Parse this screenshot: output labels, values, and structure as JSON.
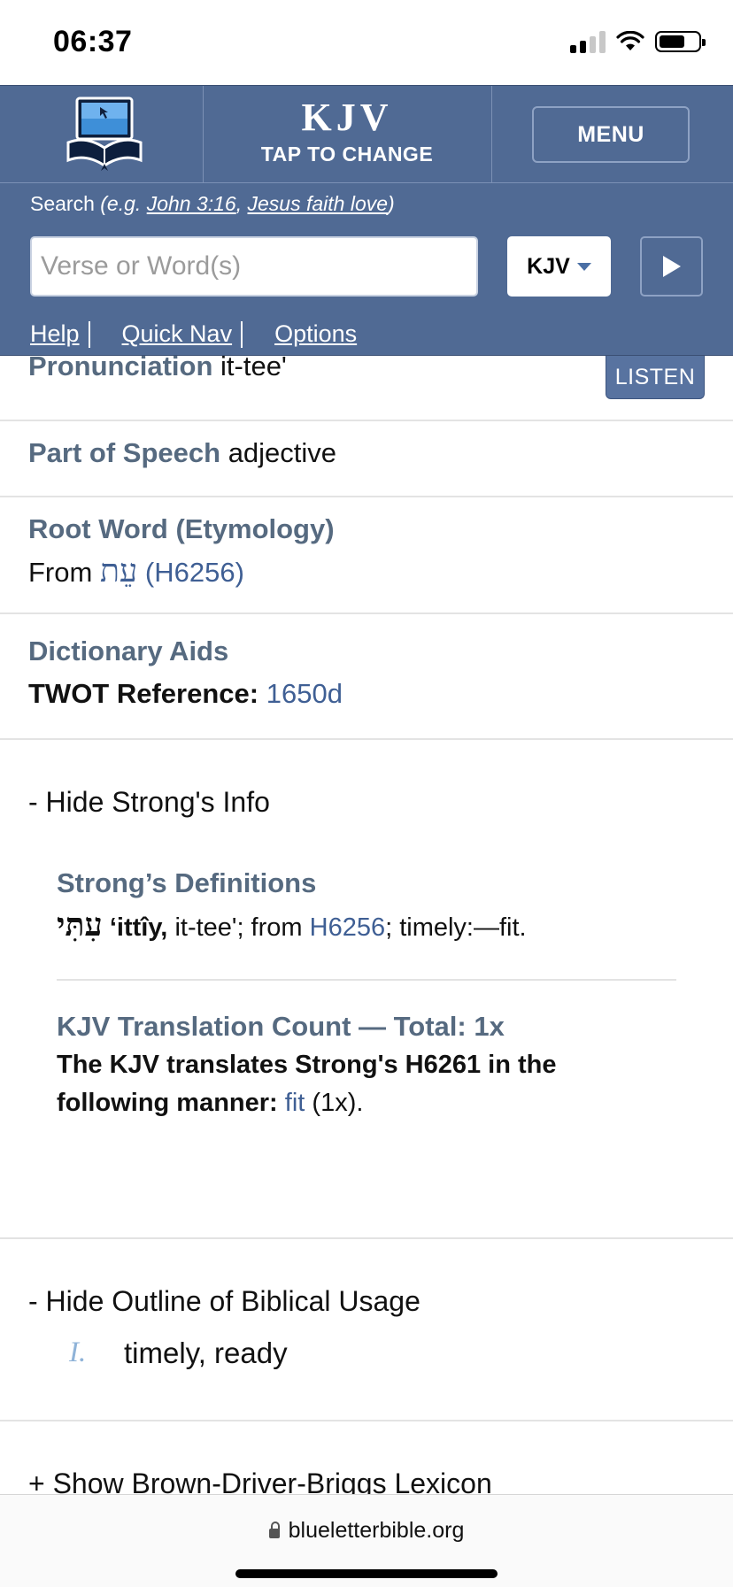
{
  "status": {
    "time": "06:37"
  },
  "header": {
    "version_name": "KJV",
    "version_sub": "TAP TO CHANGE",
    "menu_label": "MENU",
    "search": {
      "label": "Search",
      "example_prefix": "(e.g. ",
      "example1": "John 3:16",
      "example_sep": ", ",
      "example2": "Jesus faith love",
      "example_suffix": ")",
      "placeholder": "Verse or Word(s)",
      "selected_version": "KJV"
    },
    "nav": [
      "Help",
      "Quick Nav",
      "Options"
    ]
  },
  "entry": {
    "pronunciation_label": "Pronunciation",
    "pronunciation_value": "it-tee'",
    "listen_label": "LISTEN",
    "pos_label": "Part of Speech",
    "pos_value": "adjective",
    "root_label": "Root Word (Etymology)",
    "root_from": "From",
    "root_hebrew": "עֵת",
    "root_ref": "(H6256)",
    "aids_label": "Dictionary Aids",
    "twot_label": "TWOT Reference:",
    "twot_value": "1650d"
  },
  "strongs": {
    "toggle": "- Hide Strong's Info",
    "def_title": "Strong’s Definitions",
    "def_hebrew": "עִתִּי",
    "def_translit": "‘ittîy,",
    "def_pron": "it-tee'; from",
    "def_ref": "H6256",
    "def_rest": "; timely:—fit.",
    "count_title": "KJV Translation Count — Total: 1x",
    "count_text": "The KJV translates Strong's H6261 in the following manner:",
    "count_word": "fit",
    "count_times": "(1x)."
  },
  "outline": {
    "toggle": "- Hide Outline of Biblical Usage",
    "numeral": "I.",
    "item": "timely, ready"
  },
  "bdb": {
    "toggle": "+ Show Brown-Driver-Briggs Lexicon"
  },
  "browser": {
    "url": "blueletterbible.org"
  }
}
